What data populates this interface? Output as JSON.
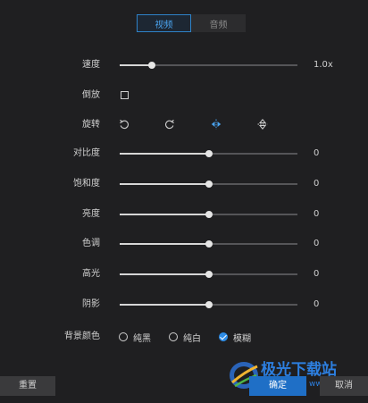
{
  "tabs": [
    {
      "label": "视频",
      "active": true
    },
    {
      "label": "音频",
      "active": false
    }
  ],
  "speed": {
    "label": "速度",
    "value": "1.0x",
    "fraction": 0.18
  },
  "reverse": {
    "label": "倒放",
    "checked": false
  },
  "rotate": {
    "label": "旋转",
    "icons": [
      "rotate-left-icon",
      "rotate-right-icon",
      "flip-horizontal-icon",
      "flip-vertical-icon"
    ]
  },
  "adjustments": [
    {
      "key": "contrast",
      "label": "对比度",
      "value": "0",
      "fraction": 0.5
    },
    {
      "key": "saturation",
      "label": "饱和度",
      "value": "0",
      "fraction": 0.5
    },
    {
      "key": "brightness",
      "label": "亮度",
      "value": "0",
      "fraction": 0.5
    },
    {
      "key": "hue",
      "label": "色调",
      "value": "0",
      "fraction": 0.5
    },
    {
      "key": "highlight",
      "label": "高光",
      "value": "0",
      "fraction": 0.5
    },
    {
      "key": "shadow",
      "label": "阴影",
      "value": "0",
      "fraction": 0.5
    }
  ],
  "background": {
    "label": "背景颜色",
    "options": [
      {
        "label": "纯黑",
        "checked": false
      },
      {
        "label": "纯白",
        "checked": false
      },
      {
        "label": "模糊",
        "checked": true
      }
    ]
  },
  "buttons": {
    "reset": "重置",
    "ok": "确定",
    "cancel": "取消"
  },
  "watermark": {
    "title": "极光下载站",
    "url": "www.xz7.com"
  },
  "colors": {
    "accent": "#2d8ce6",
    "background": "#1f1f21",
    "ok_button": "#1f6fc6"
  }
}
